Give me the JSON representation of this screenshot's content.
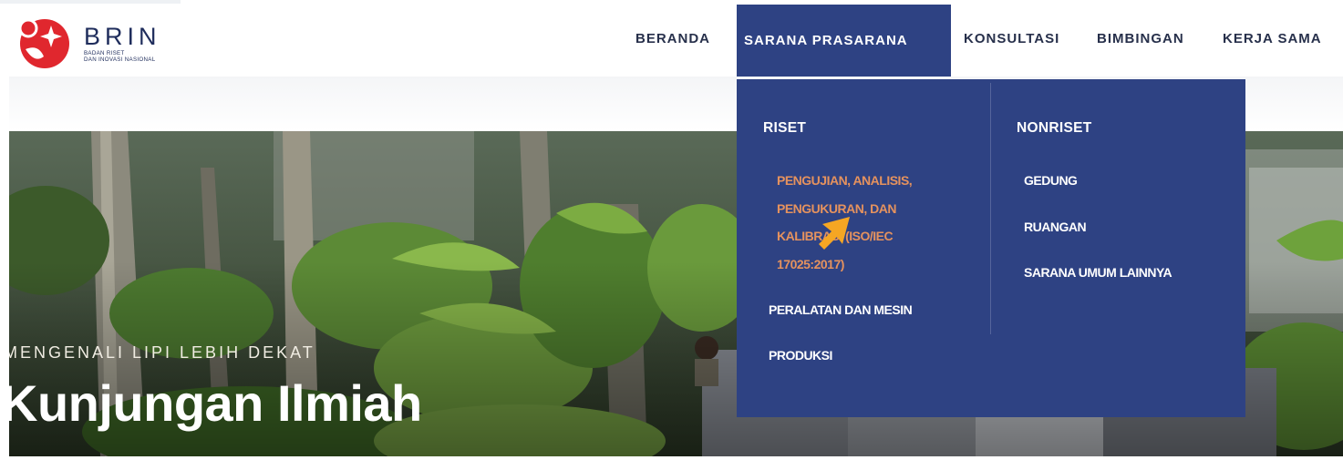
{
  "brand": {
    "name": "BRIN",
    "subtitle_line1": "BADAN RISET",
    "subtitle_line2": "DAN INOVASI NASIONAL",
    "colors": {
      "logo_red": "#e0272e",
      "brand_navy": "#1f2d5c"
    }
  },
  "nav": {
    "items": [
      {
        "label": "BERANDA"
      },
      {
        "label": "SARANA PRASARANA",
        "active": true
      },
      {
        "label": "KONSULTASI"
      },
      {
        "label": "BIMBINGAN"
      },
      {
        "label": "KERJA SAMA"
      }
    ]
  },
  "dropdown": {
    "riset": {
      "heading": "RISET",
      "pengujian_lines": [
        "PENGUJIAN, ANALISIS,",
        "PENGUKURAN, DAN",
        "KALIBRASI (ISO/IEC",
        "17025:2017)"
      ],
      "peralatan": "PERALATAN DAN MESIN",
      "produksi": "PRODUKSI"
    },
    "nonriset": {
      "heading": "NONRISET",
      "gedung": "GEDUNG",
      "ruangan": "RUANGAN",
      "sarana_umum": "SARANA UMUM LAINNYA"
    }
  },
  "hero": {
    "kicker": "MENGENALI LIPI LEBIH DEKAT",
    "title": "Kunjungan Ilmiah"
  },
  "colors": {
    "menu_background": "#2e4283",
    "accent": "#c5895b",
    "hover_text": "#e5925e",
    "cursor": "#f5a623"
  },
  "icons": {
    "cursor": "pointer-arrow-icon"
  }
}
